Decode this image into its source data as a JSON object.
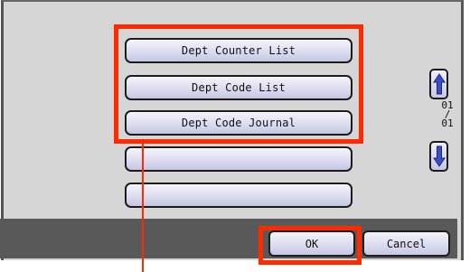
{
  "list": {
    "items": [
      "Dept Counter List",
      "Dept Code List",
      "Dept Code Journal",
      "",
      ""
    ]
  },
  "pager": {
    "current": "01",
    "separator": "/",
    "total": "01",
    "up_icon": "arrow-up-icon",
    "down_icon": "arrow-down-icon"
  },
  "actions": {
    "ok_label": "OK",
    "cancel_label": "Cancel"
  },
  "colors": {
    "highlight": "#ff2a00",
    "button_face": "#dcdcf0",
    "arrow_fill": "#3b4fc4"
  }
}
